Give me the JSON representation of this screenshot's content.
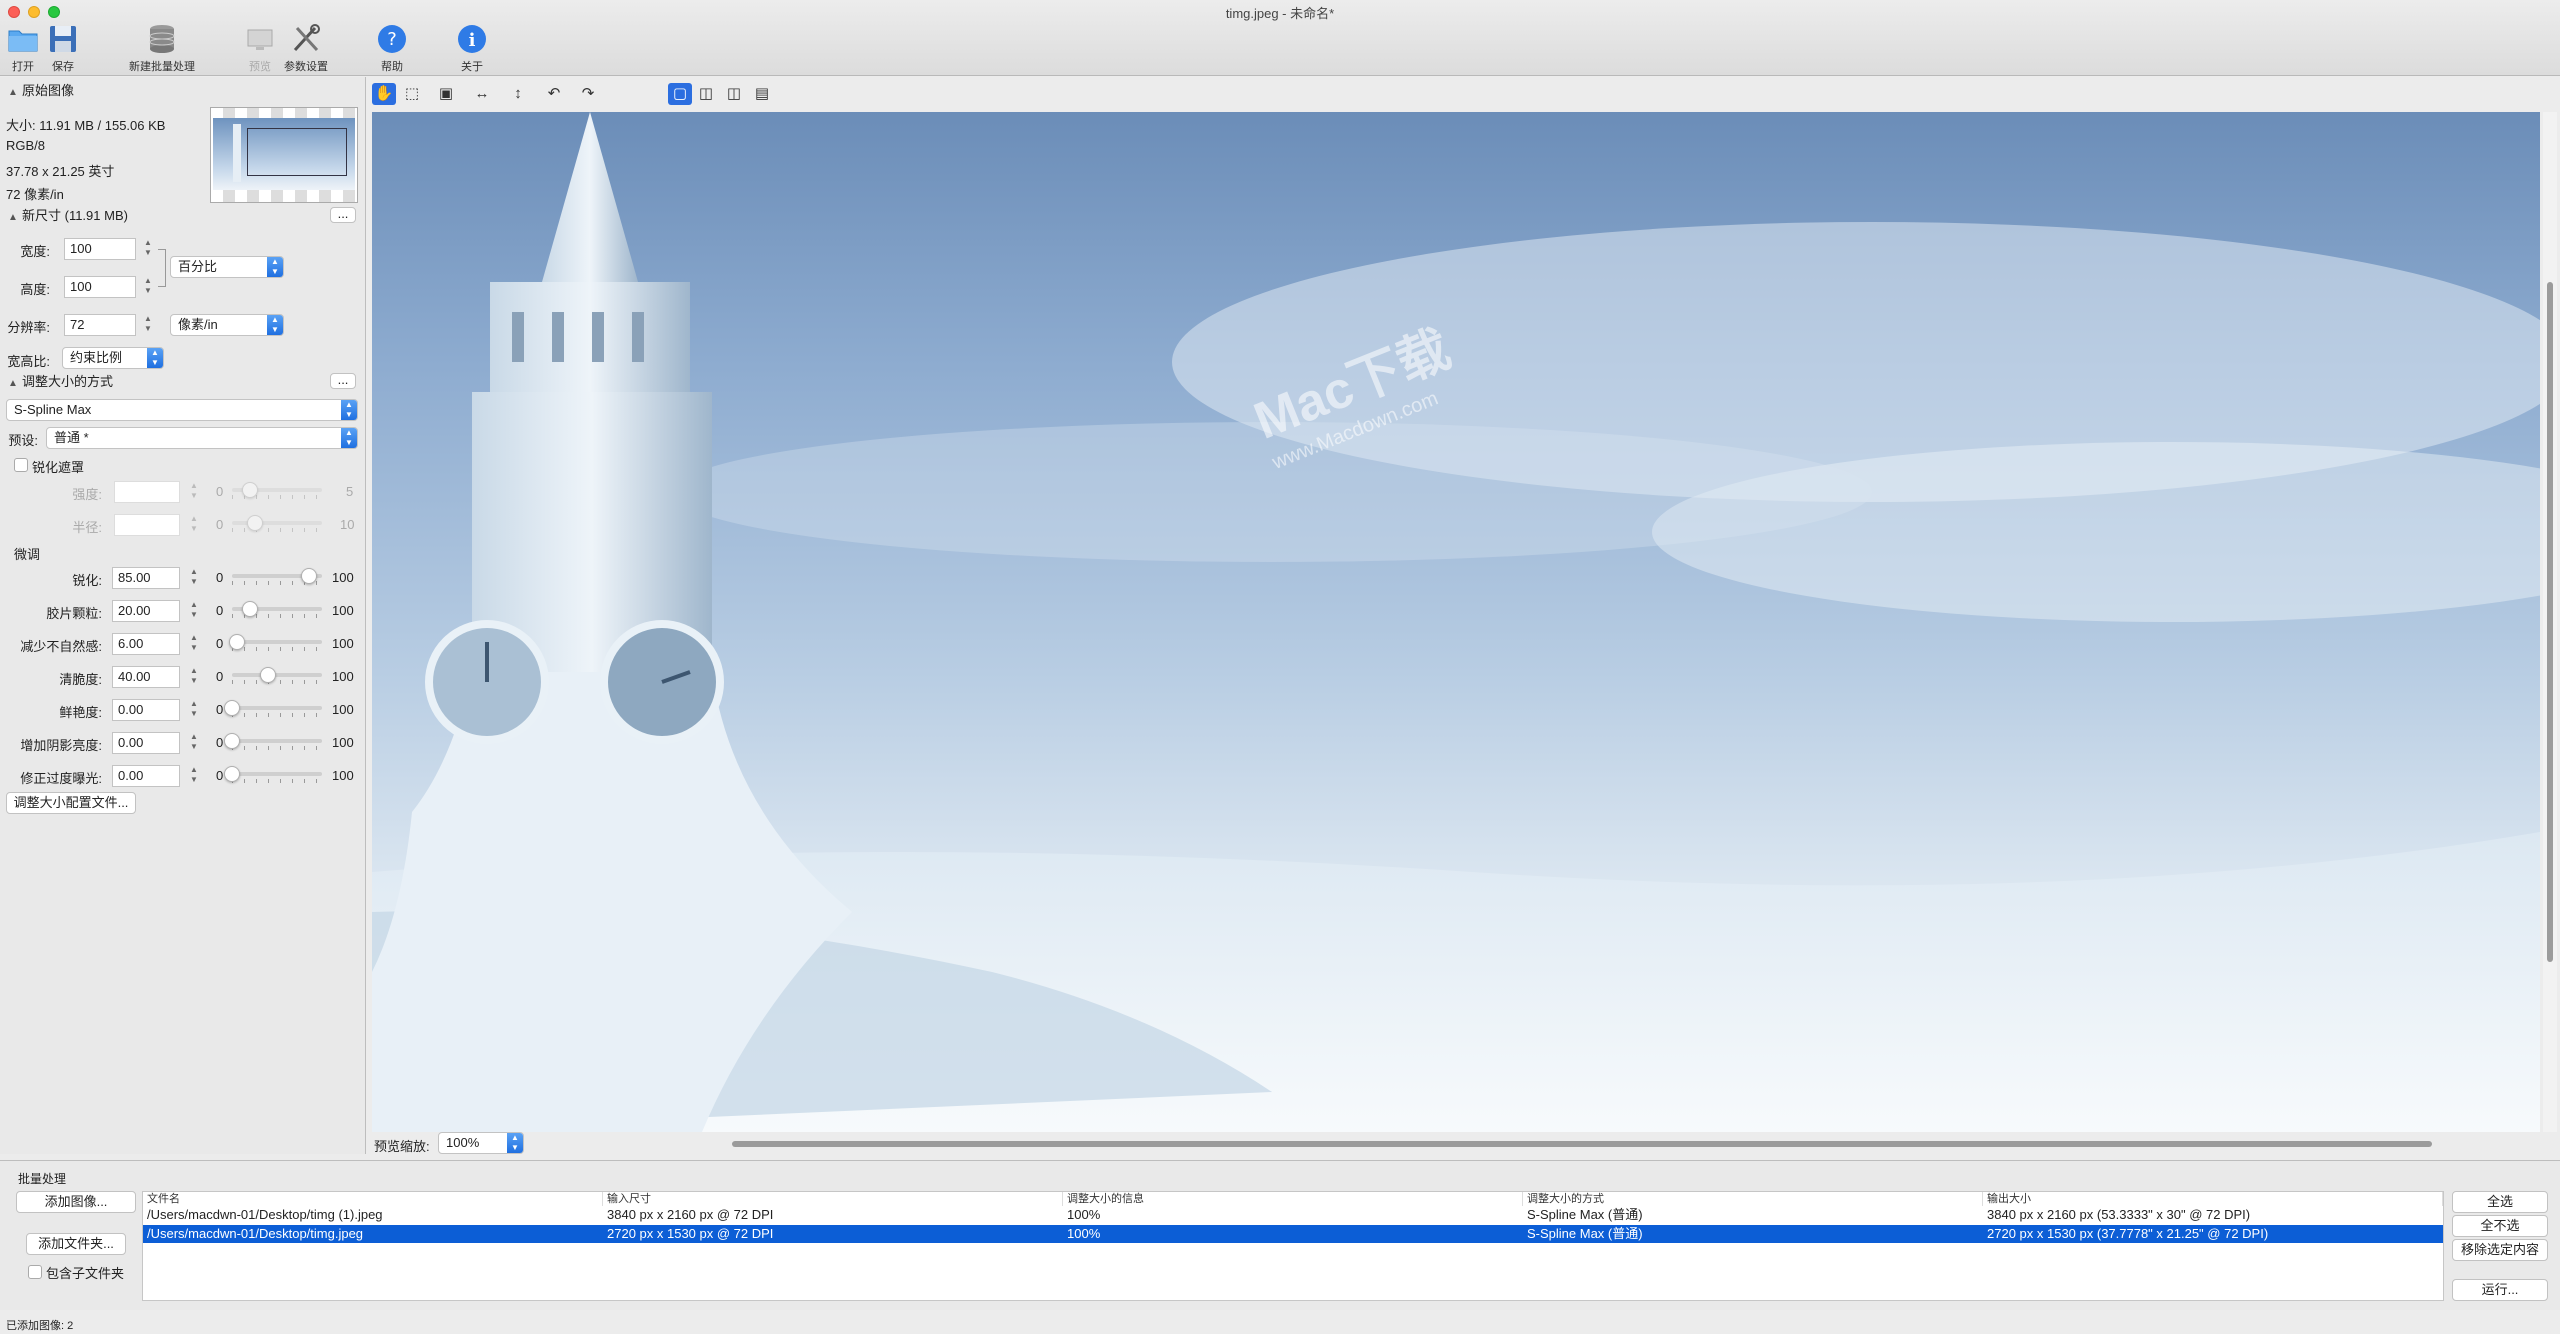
{
  "window": {
    "title": "timg.jpeg - 未命名*"
  },
  "toolbar": {
    "open": "打开",
    "save": "保存",
    "new_batch": "新建批量处理",
    "preview": "预览",
    "preferences": "参数设置",
    "help": "帮助",
    "about": "关于"
  },
  "original": {
    "header": "原始图像",
    "size": "大小: 11.91 MB / 155.06 KB",
    "mode": "RGB/8",
    "dimensions": "37.78 x 21.25 英寸",
    "resolution": "72 像素/in"
  },
  "new_size": {
    "header": "新尺寸 (11.91 MB)",
    "width_label": "宽度:",
    "width_value": "100",
    "height_label": "高度:",
    "height_value": "100",
    "unit": "百分比",
    "resolution_label": "分辨率:",
    "resolution_value": "72",
    "resolution_unit": "像素/in",
    "aspect_label": "宽高比:",
    "aspect_value": "约束比例",
    "more": "..."
  },
  "method": {
    "header": "调整大小的方式",
    "algorithm": "S-Spline Max",
    "preset_label": "预设:",
    "preset_value": "普通 *",
    "more": "..."
  },
  "sharpen_mask": {
    "label": "锐化遮罩",
    "strength_label": "强度:",
    "strength_min": "0",
    "strength_max": "5",
    "radius_label": "半径:",
    "radius_min": "0",
    "radius_max": "10"
  },
  "fine_tune": {
    "header": "微调",
    "rows": [
      {
        "label": "锐化:",
        "value": "85.00",
        "min": "0",
        "max": "100",
        "pos": 85
      },
      {
        "label": "胶片颗粒:",
        "value": "20.00",
        "min": "0",
        "max": "100",
        "pos": 20
      },
      {
        "label": "减少不自然感:",
        "value": "6.00",
        "min": "0",
        "max": "100",
        "pos": 6
      },
      {
        "label": "清脆度:",
        "value": "40.00",
        "min": "0",
        "max": "100",
        "pos": 40
      },
      {
        "label": "鲜艳度:",
        "value": "0.00",
        "min": "0",
        "max": "100",
        "pos": 0
      },
      {
        "label": "增加阴影亮度:",
        "value": "0.00",
        "min": "0",
        "max": "100",
        "pos": 0
      },
      {
        "label": "修正过度曝光:",
        "value": "0.00",
        "min": "0",
        "max": "100",
        "pos": 0
      }
    ],
    "profile_button": "调整大小配置文件..."
  },
  "preview_bar": {
    "zoom_label": "预览缩放:",
    "zoom_value": "100%"
  },
  "watermark": {
    "brand": "Mac下载",
    "site": "www.Macdown.com"
  },
  "batch": {
    "title": "批量处理",
    "add_images": "添加图像...",
    "add_folder": "添加文件夹...",
    "include_subfolders": "包含子文件夹",
    "columns": [
      "文件名",
      "输入尺寸",
      "调整大小的信息",
      "调整大小的方式",
      "输出大小"
    ],
    "rows": [
      [
        "/Users/macdwn-01/Desktop/timg (1).jpeg",
        "3840 px x 2160 px @ 72 DPI",
        "100%",
        "S-Spline Max (普通)",
        "3840 px x 2160 px (53.3333\" x 30\" @ 72 DPI)"
      ],
      [
        "/Users/macdwn-01/Desktop/timg.jpeg",
        "2720 px x 1530 px @ 72 DPI",
        "100%",
        "S-Spline Max (普通)",
        "2720 px x 1530 px (37.7778\" x 21.25\" @ 72 DPI)"
      ]
    ],
    "select_all": "全选",
    "select_none": "全不选",
    "remove_selected": "移除选定内容",
    "run": "运行..."
  },
  "status": "已添加图像: 2"
}
